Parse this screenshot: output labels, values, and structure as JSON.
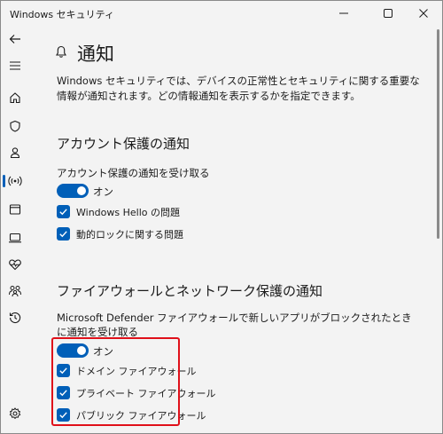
{
  "window": {
    "title": "Windows セキュリティ",
    "controls": [
      "minimize-icon",
      "maximize-icon",
      "close-icon"
    ]
  },
  "sidebar": {
    "items": [
      {
        "icon": "back-arrow-icon"
      },
      {
        "icon": "menu-icon"
      },
      {
        "icon": "home-icon"
      },
      {
        "icon": "shield-icon"
      },
      {
        "icon": "person-icon"
      },
      {
        "icon": "network-icon",
        "active": true
      },
      {
        "icon": "app-browser-icon"
      },
      {
        "icon": "device-icon"
      },
      {
        "icon": "heart-pulse-icon"
      },
      {
        "icon": "family-icon"
      },
      {
        "icon": "history-icon"
      },
      {
        "icon": "settings-icon"
      }
    ]
  },
  "page": {
    "title": "通知",
    "description": "Windows セキュリティでは、デバイスの正常性とセキュリティに関する重要な情報が通知されます。どの情報通知を表示するかを指定できます。"
  },
  "account_section": {
    "title": "アカウント保護の通知",
    "receive_label": "アカウント保護の通知を受け取る",
    "toggle_label": "オン",
    "toggle_on": true,
    "checks": [
      {
        "label": "Windows Hello の問題",
        "checked": true
      },
      {
        "label": "動的ロックに関する問題",
        "checked": true
      }
    ]
  },
  "firewall_section": {
    "title": "ファイアウォールとネットワーク保護の通知",
    "receive_label": "Microsoft Defender ファイアウォールで新しいアプリがブロックされたときに通知を受け取る",
    "toggle_label": "オン",
    "toggle_on": true,
    "checks": [
      {
        "label": "ドメイン ファイアウォール",
        "checked": true
      },
      {
        "label": "プライベート ファイアウォール",
        "checked": true
      },
      {
        "label": "パブリック ファイアウォール",
        "checked": true
      }
    ]
  },
  "colors": {
    "accent": "#005fb8",
    "highlight": "#e0101a",
    "background": "#f3f3f3"
  }
}
